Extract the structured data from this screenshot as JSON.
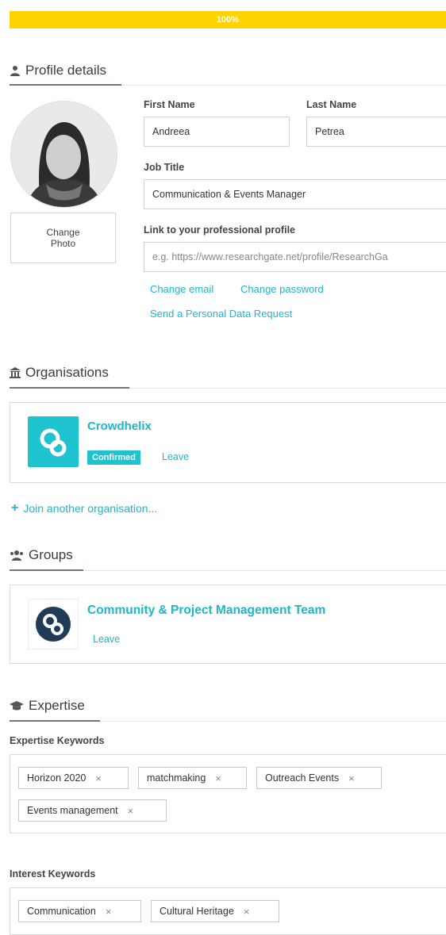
{
  "progress": {
    "label": "100%",
    "fraction": 1.0,
    "color": "#ffd400"
  },
  "profile": {
    "heading": "Profile details",
    "change_photo": "Change\nPhoto",
    "first_name_label": "First Name",
    "first_name_value": "Andreea",
    "last_name_label": "Last Name",
    "last_name_value": "Petrea",
    "job_title_label": "Job Title",
    "job_title_value": "Communication & Events Manager",
    "link_label": "Link to your professional profile",
    "link_placeholder": "e.g. https://www.researchgate.net/profile/ResearchGa",
    "change_email": "Change email",
    "change_password": "Change password",
    "data_request": "Send a Personal Data Request"
  },
  "organisations": {
    "heading": "Organisations",
    "items": [
      {
        "name": "Crowdhelix",
        "status": "Confirmed",
        "action": "Leave"
      }
    ],
    "join_label": "Join another organisation..."
  },
  "groups": {
    "heading": "Groups",
    "items": [
      {
        "name": "Community & Project Management Team",
        "action": "Leave"
      }
    ]
  },
  "expertise": {
    "heading": "Expertise",
    "expertise_label": "Expertise Keywords",
    "expertise_tags": [
      "Horizon 2020",
      "matchmaking",
      "Outreach Events",
      "Events management"
    ],
    "interest_label": "Interest Keywords",
    "interest_tags": [
      "Communication",
      "Cultural Heritage"
    ],
    "remove_glyph": "×"
  },
  "colors": {
    "accent": "#1fb6c8",
    "badge": "#1fc3cf",
    "progress": "#ffd400"
  }
}
